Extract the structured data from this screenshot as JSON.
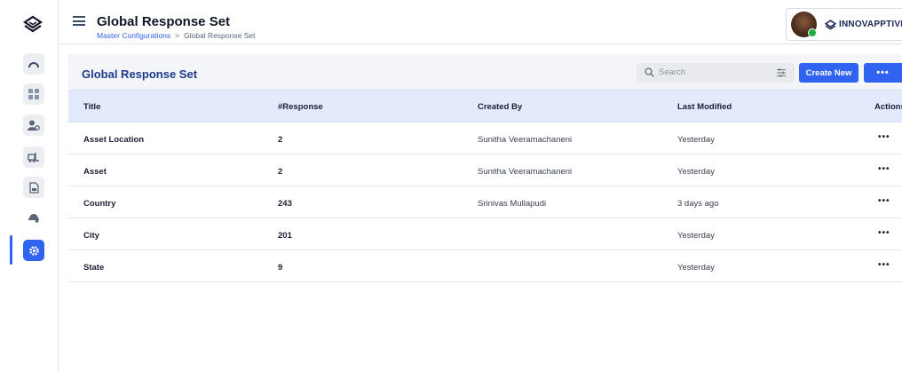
{
  "header": {
    "title": "Global Response Set",
    "breadcrumb": {
      "link": "Master Configurations",
      "separator": ">",
      "current": "Global Response Set"
    }
  },
  "brand": {
    "name": "INNOVAPPTIVE",
    "avatar_status_color": "#1fae3a"
  },
  "sidebar": {
    "items": [
      {
        "icon": "dashboard-gauge-icon"
      },
      {
        "icon": "grid-icon"
      },
      {
        "icon": "user-settings-icon"
      },
      {
        "icon": "forklift-icon"
      },
      {
        "icon": "document-icon"
      },
      {
        "icon": "helmet-icon"
      },
      {
        "icon": "gear-icon",
        "active": true
      }
    ]
  },
  "card": {
    "title": "Global Response Set",
    "search_placeholder": "Search",
    "create_label": "Create New",
    "more_label": "•••"
  },
  "table": {
    "columns": [
      "Title",
      "#Response",
      "Created By",
      "Last Modified",
      "Actions"
    ],
    "rows": [
      {
        "title": "Asset Location",
        "response": "2",
        "created_by": "Sunitha Veeramachaneni",
        "last_modified": "Yesterday",
        "actions": "•••"
      },
      {
        "title": "Asset",
        "response": "2",
        "created_by": "Sunitha Veeramachaneni",
        "last_modified": "Yesterday",
        "actions": "•••"
      },
      {
        "title": "Country",
        "response": "243",
        "created_by": "Srinivas Mullapudi",
        "last_modified": "3 days ago",
        "actions": "•••"
      },
      {
        "title": "City",
        "response": "201",
        "created_by": "",
        "last_modified": "Yesterday",
        "actions": "•••"
      },
      {
        "title": "State",
        "response": "9",
        "created_by": "",
        "last_modified": "Yesterday",
        "actions": "•••"
      }
    ]
  },
  "colors": {
    "accent": "#3064f0",
    "title_blue": "#1e3a8a",
    "header_row_bg": "#e3eafc"
  }
}
